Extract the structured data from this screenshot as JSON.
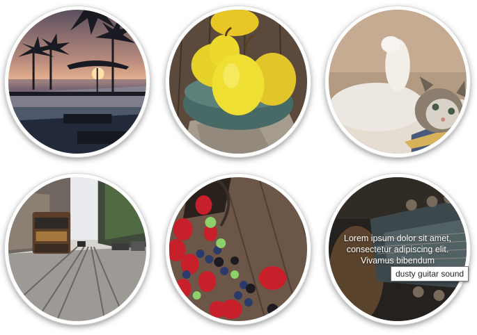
{
  "gallery": {
    "items": [
      {
        "name": "sunset-pool-palms"
      },
      {
        "name": "pears-bowl"
      },
      {
        "name": "kitten-playing"
      },
      {
        "name": "city-street-tram"
      },
      {
        "name": "berries-basket"
      },
      {
        "name": "guitar-headstock",
        "caption": "Lorem ipsum dolor sit amet, consectetur adipiscing elit. Vivamus bibendum"
      }
    ]
  },
  "tooltip": {
    "text": "dusty guitar sound"
  }
}
